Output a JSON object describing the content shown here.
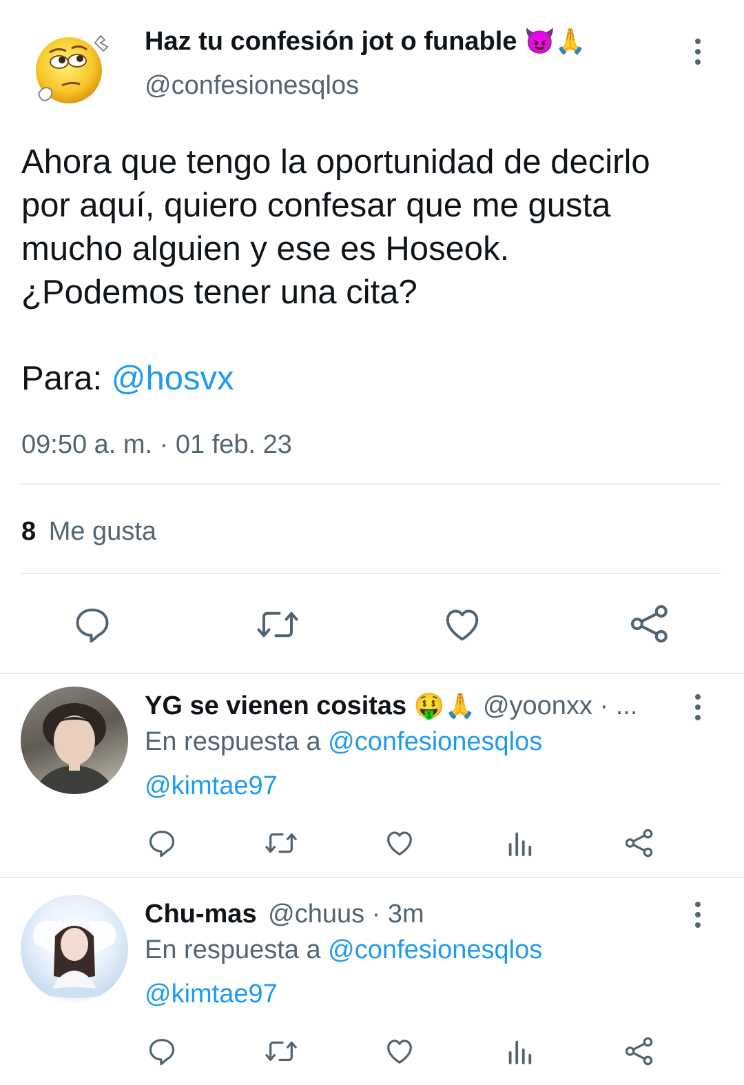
{
  "tweet": {
    "display_name": "Haz tu confesión jot o funable",
    "name_emojis": "😈🙏",
    "handle": "@confesionesqlos",
    "body_lines": [
      "Ahora que tengo la oportunidad de decirlo",
      "por aquí, quiero confesar que me gusta",
      "mucho alguien y ese es Hoseok.",
      "¿Podemos tener una cita?"
    ],
    "para_label": "Para:",
    "para_mention": "@hosvx",
    "timestamp": "09:50 a. m. · 01 feb. 23",
    "likes_count": "8",
    "likes_label": "Me gusta"
  },
  "replies": [
    {
      "display_name": "YG se vienen cositas",
      "name_emojis": "🤑🙏",
      "handle_meta": "@yoonxx · ...",
      "reply_prefix": "En respuesta a",
      "reply_to": "@confesionesqlos",
      "body": "@kimtae97"
    },
    {
      "display_name": "Chu-mas",
      "handle_meta": "@chuus · 3m",
      "reply_prefix": "En respuesta a",
      "reply_to": "@confesionesqlos",
      "body": "@kimtae97"
    }
  ],
  "colors": {
    "accent": "#1d9bf0",
    "text": "#0f1419",
    "muted": "#536471",
    "divider": "#e6ecf0"
  },
  "icons": [
    "reply-icon",
    "retweet-icon",
    "like-icon",
    "share-icon",
    "views-icon",
    "more-icon"
  ]
}
